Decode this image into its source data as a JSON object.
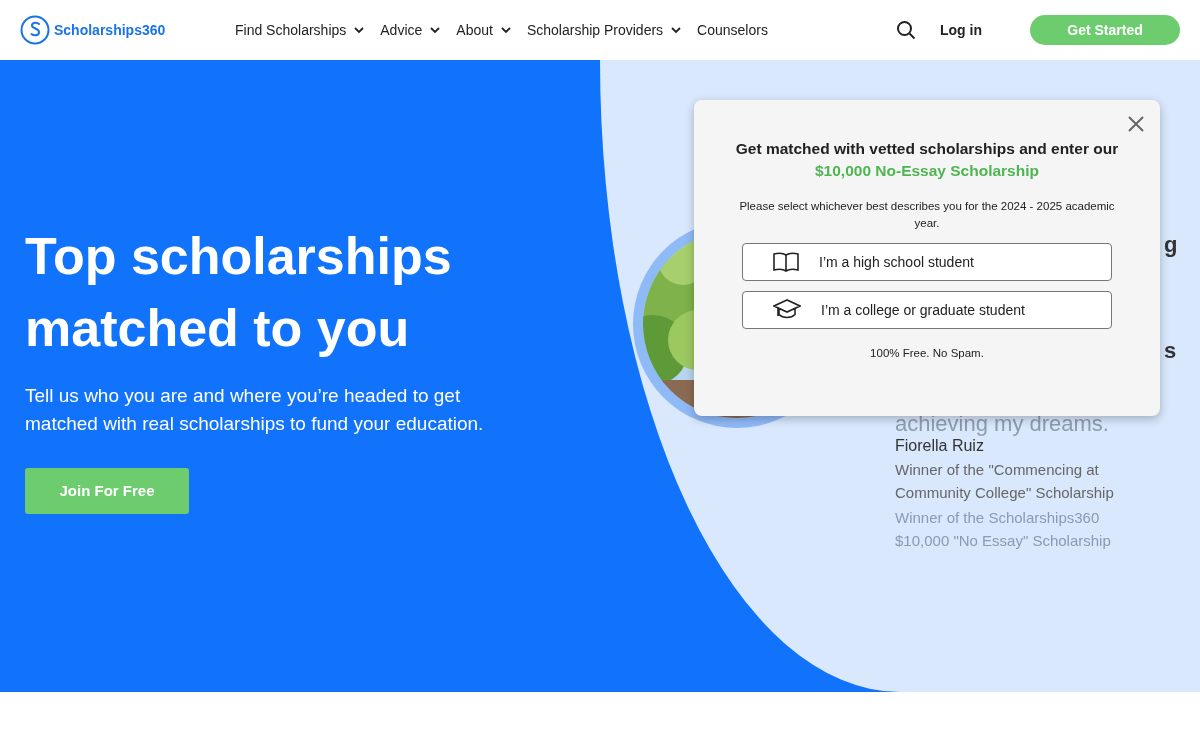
{
  "header": {
    "logo_text": "Scholarships360",
    "nav": [
      {
        "label": "Find Scholarships",
        "dropdown": true
      },
      {
        "label": "Advice",
        "dropdown": true
      },
      {
        "label": "About",
        "dropdown": true
      },
      {
        "label": "Scholarship Providers",
        "dropdown": true
      },
      {
        "label": "Counselors",
        "dropdown": false
      }
    ],
    "login": "Log in",
    "cta": "Get Started"
  },
  "hero": {
    "title": "Top scholarships matched to you",
    "subtitle": "Tell us who you are and where you’re headed to get matched with real scholarships to fund your education.",
    "button": "Join For Free"
  },
  "testimonial": {
    "quote_fragments": [
      "g",
      "s"
    ],
    "quote_end": "achieving my dreams.",
    "name": "Fiorella Ruiz",
    "award": "Winner of the \"Commencing at Community College\" Scholarship",
    "faded_award": "Winner of the Scholarships360 $10,000 \"No Essay\" Scholarship"
  },
  "modal": {
    "title": "Get matched with vetted scholarships and enter our **$10,000 No-Essay Scholarship**",
    "prompt": "Please select whichever best describes you for the 2024 - 2025 academic year.",
    "options": [
      {
        "kind": "book",
        "label": "I’m a high school student"
      },
      {
        "kind": "cap",
        "label": "I’m a college or graduate student"
      }
    ],
    "note": "100% Free. No Spam."
  }
}
